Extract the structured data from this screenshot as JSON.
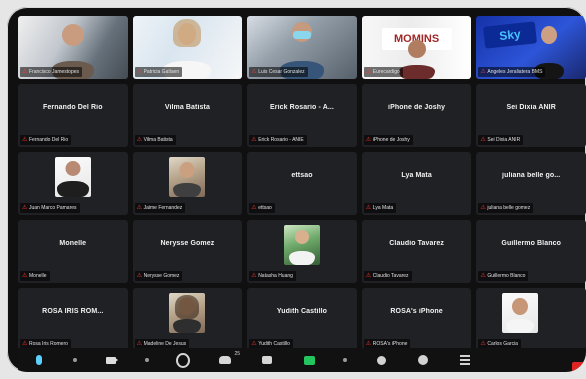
{
  "participants": [
    {
      "display_name": "",
      "label": "Francisco Jamestopes",
      "tile_type": "video"
    },
    {
      "display_name": "",
      "label": "Patricia Gatlaen",
      "tile_type": "video"
    },
    {
      "display_name": "",
      "label": "Luis Cesar Gonzalez",
      "tile_type": "video"
    },
    {
      "display_name": "",
      "label": "Eurecardigo",
      "tile_type": "video-logo",
      "logo_text": "MOMINS"
    },
    {
      "display_name": "",
      "label": "Angeles Jeraliatera BMS",
      "tile_type": "video-blue",
      "logo_text": "Sky"
    },
    {
      "display_name": "Fernando Del Rio",
      "label": "Fernando Del Rio",
      "tile_type": "name"
    },
    {
      "display_name": "Vilma Batista",
      "label": "Vilma Batista",
      "tile_type": "name"
    },
    {
      "display_name": "Erick Rosario - A...",
      "label": "Erick Rosario - ANIE",
      "tile_type": "name"
    },
    {
      "display_name": "iPhone de Joshy",
      "label": "iPhone de Joshy",
      "tile_type": "name"
    },
    {
      "display_name": "Sei Dixia ANIR",
      "label": "Sei Dixia ANIR",
      "tile_type": "name"
    },
    {
      "display_name": "",
      "label": "Juan Marco Pamares",
      "tile_type": "photo-male"
    },
    {
      "display_name": "",
      "label": "Jaime Fernandez",
      "tile_type": "photo-car"
    },
    {
      "display_name": "ettsao",
      "label": "ettsao",
      "tile_type": "name"
    },
    {
      "display_name": "Lya Mata",
      "label": "Lya Mata",
      "tile_type": "name"
    },
    {
      "display_name": "juliana belle go...",
      "label": "juliana belle gomez",
      "tile_type": "name"
    },
    {
      "display_name": "Monelle",
      "label": "Monelle",
      "tile_type": "name"
    },
    {
      "display_name": "Nerysse Gomez",
      "label": "Nerysse Gomez",
      "tile_type": "name"
    },
    {
      "display_name": "",
      "label": "Natasha Huang",
      "tile_type": "photo-outdoor"
    },
    {
      "display_name": "Claudio Tavarez",
      "label": "Claudio Tavarez",
      "tile_type": "name"
    },
    {
      "display_name": "Guillermo Blanco",
      "label": "Guillermo Blanco",
      "tile_type": "name"
    },
    {
      "display_name": "ROSA IRIS ROM...",
      "label": "Rosa Iris Romero",
      "tile_type": "name"
    },
    {
      "display_name": "",
      "label": "Madeline De Jesus",
      "tile_type": "photo-female"
    },
    {
      "display_name": "Yudith Castillo",
      "label": "Yudith Castillo",
      "tile_type": "name"
    },
    {
      "display_name": "ROSA's iPhone",
      "label": "ROSA's iPhone",
      "tile_type": "name"
    },
    {
      "display_name": "",
      "label": "Carlos Garcia",
      "tile_type": "photo-smile"
    }
  ],
  "toolbar": {
    "participants_count": "25"
  },
  "colors": {
    "window_bg": "#101010",
    "tile_bg": "#202124",
    "muted_icon": "#ff3b30",
    "share_green": "#22c55e",
    "end_red": "#e02424"
  }
}
